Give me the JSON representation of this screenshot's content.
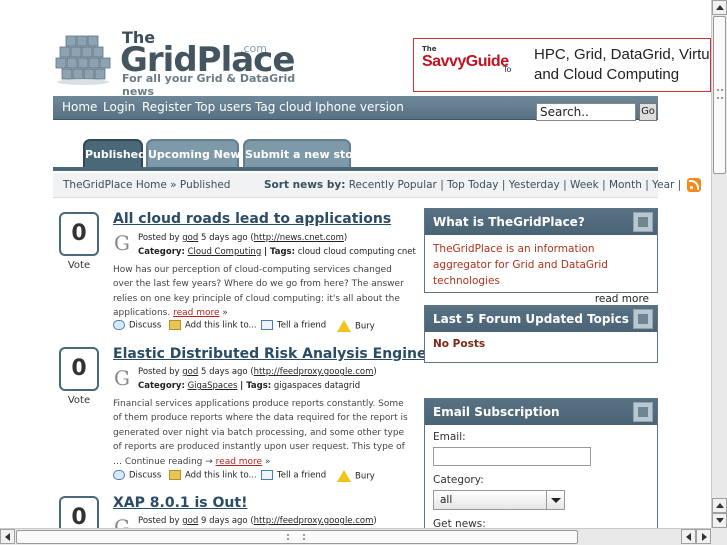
{
  "site": {
    "logo_the": "The",
    "logo_main": "GridPlace",
    "logo_com": ".com",
    "logo_tagline": "For all your Grid & DataGrid news"
  },
  "ad": {
    "the": "The",
    "brand": "SavvyGuide",
    "to": "To",
    "text": "HPC, Grid, DataGrid, Virtua and Cloud Computing"
  },
  "nav": {
    "items": [
      "Home",
      "Login",
      "Register",
      "Top users",
      "Tag cloud",
      "Iphone version"
    ],
    "search_value": "Search..",
    "search_button": "Go"
  },
  "tabs": [
    "Published",
    "Upcoming News",
    "Submit a new story"
  ],
  "breadcrumb": "TheGridPlace Home » Published",
  "sort": {
    "label": "Sort news by:",
    "options": [
      "Recently Popular",
      "Top Today",
      "Yesterday",
      "Week",
      "Month",
      "Year"
    ]
  },
  "stories": [
    {
      "votes": "0",
      "vote_label": "Vote",
      "title": "All cloud roads lead to applications",
      "posted_by": "Posted by",
      "author": "god",
      "time": "5 days ago",
      "source": "http://news.cnet.com",
      "category_label": "Category:",
      "category": "Cloud Computing",
      "tags_label": "| Tags:",
      "tags": "cloud cloud computing cnet",
      "description": "How has our perception of cloud-computing services changed over the last few years? Where do we go from here? The answer relies on one key principle of cloud computing: it's all about the applications.",
      "more": "read more",
      "more_suffix": "»"
    },
    {
      "votes": "0",
      "vote_label": "Vote",
      "title": "Elastic Distributed Risk Analysis Engine",
      "posted_by": "Posted by",
      "author": "god",
      "time": "5 days ago",
      "source": "http://feedproxy.google.com",
      "category_label": "Category:",
      "category": "GigaSpaces",
      "tags_label": "| Tags:",
      "tags": "gigaspaces datagrid",
      "description": "Financial services applications produce reports constantly. Some of them produce reports where the data required for the report is generated over night  via batch processing, and some other type of reports are produced instantly upon user request. This type of … Continue reading →",
      "more": "read more",
      "more_suffix": "»"
    },
    {
      "votes": "0",
      "vote_label": "Vote",
      "title": "XAP 8.0.1 is Out!",
      "posted_by": "Posted by",
      "author": "god",
      "time": "9 days ago",
      "source": "http://feedproxy.google.com"
    }
  ],
  "actions": {
    "discuss": "Discuss",
    "add_link": "Add this link to...",
    "tell": "Tell a friend",
    "bury": "Bury"
  },
  "sidebar": {
    "about": {
      "title": "What is TheGridPlace?",
      "text": "TheGridPlace is an information aggregator for Grid and DataGrid technologies",
      "more": "read more"
    },
    "forum": {
      "title": "Last 5 Forum Updated Topics",
      "text": "No Posts"
    },
    "subscribe": {
      "title": "Email Subscription",
      "email_label": "Email:",
      "category_label": "Category:",
      "category_value": "all",
      "news_label": "Get news:"
    }
  }
}
